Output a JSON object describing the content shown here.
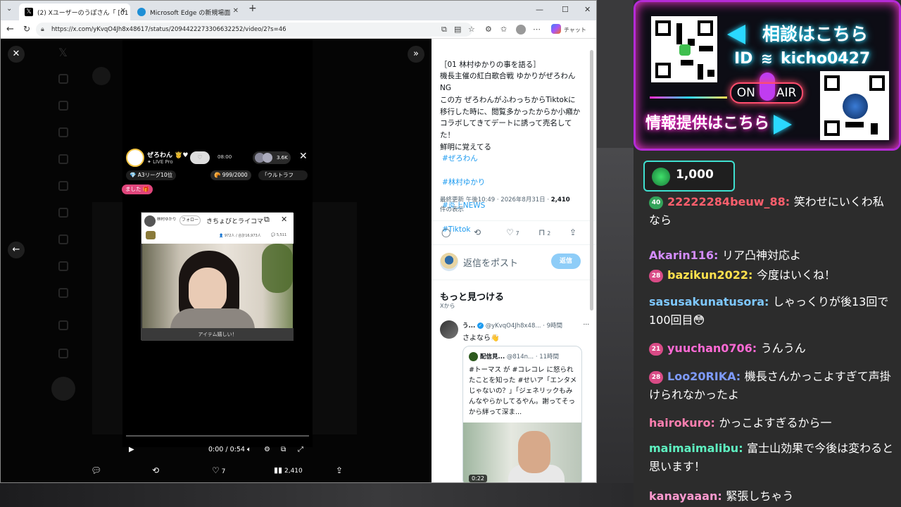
{
  "browser": {
    "tabs": [
      {
        "label": "(2) Xユーザーのうぽさん「 [01 林村ゆ",
        "icon": "x-logo-icon"
      },
      {
        "label": "Microsoft Edge の新規場面",
        "icon": "edge-icon"
      }
    ],
    "url": "https://x.com/yKvqO4Jh8x48617/status/2094422273306632252/video/2?s=46",
    "chat_label": "チャット"
  },
  "overlay": {
    "live": {
      "name": "ぜろわん",
      "sub": "LIVE Pro",
      "time": "08:00",
      "viewers": "3.6K",
      "league": "A3リーグ10位",
      "points": "999/2000",
      "ultra": "「ウルトラフ",
      "pink_pill": "ました"
    },
    "sub_window": {
      "name": "林村ゆかり",
      "follow": "フォロー",
      "title": "きちょびとライコマ",
      "stats": "972人 / 合計16,973人",
      "comments": "5,511",
      "caption": "アイテム嬉しい！"
    },
    "video": {
      "time": "0:00 / 0:54"
    },
    "actions": {
      "likes": "7",
      "views": "2,410"
    }
  },
  "tweet": {
    "text": "［01 林村ゆかりの事を語る］\n機長主催の紅白歌合戦 ゆかりがぜろわんNG\nこの方 ぜろわんがふわっちからTiktokに移行した時に、閲覧多かったからか小癪かコラボしてきてデートに誘って売名してた！\n鮮明に覚えてる",
    "hashtags": [
      "#ぜろわん",
      "#林村ゆかり",
      "#炎上NEWS",
      "#Tiktok"
    ],
    "meta": "最終更新 午後10:49 · 2026年8月31日 · ",
    "views": "2,410",
    "views_label": "件の表示",
    "likes": "7",
    "bookmarks": "2",
    "reply_placeholder": "返信をポスト",
    "reply_button": "返信",
    "more_title": "もっと見つける",
    "more_sub": "Xから",
    "rt": {
      "name": "う...",
      "handle": "@yKvqO4Jh8x48...",
      "time": "· 9時間",
      "text": "さよなら👋"
    },
    "quote": {
      "name": "配信見...",
      "handle": "@814n...",
      "time": "· 11時間",
      "text": "#トーマス が #コレコレ に怒られたことを知った #せいア「エンタメじゃないの？」「ジェネリックもみんなやらかしてるやん。謝ってそっから絆って深ま...",
      "video_time": "0:22"
    }
  },
  "stream": {
    "consult": "相談はこちら",
    "id_label": "ID",
    "id_value": "kicho0427",
    "on": "ON",
    "air": "AIR",
    "info": "情報提供はこちら",
    "gift_amount": "1,000",
    "messages": [
      {
        "badge": "40",
        "user": "22222284beuw_88",
        "text": "笑わせにいくわ私なら",
        "color": "#ff5f6d"
      },
      {
        "badge": "",
        "user": "Akarin116",
        "text": "リア凸神対応よ",
        "color": "#d48cff"
      },
      {
        "badge": "28",
        "user": "bazikun2022",
        "text": "今度はいくね！",
        "color": "#ffe14d"
      },
      {
        "badge": "",
        "user": "sasusakunatusora",
        "text": "しゃっくりが後13回で100回目😳",
        "color": "#7ec8ff"
      },
      {
        "badge": "21",
        "user": "yuuchan0706",
        "text": "うんうん",
        "color": "#ff6ad5"
      },
      {
        "badge": "28",
        "user": "Loo20RIKA",
        "text": "機長さんかっこよすぎて声掛けられなかったよ",
        "color": "#7e9bff"
      },
      {
        "badge": "",
        "user": "hairokuro",
        "text": "かっこよすぎるから一",
        "color": "#ff7fb0"
      },
      {
        "badge": "",
        "user": "maimaimalibu",
        "text": "富士山効果で今後は変わると思います！",
        "color": "#5ef0c0"
      },
      {
        "badge": "",
        "user": "kanayaaan",
        "text": "緊張しちゃう",
        "color": "#ff9ad0"
      }
    ]
  }
}
